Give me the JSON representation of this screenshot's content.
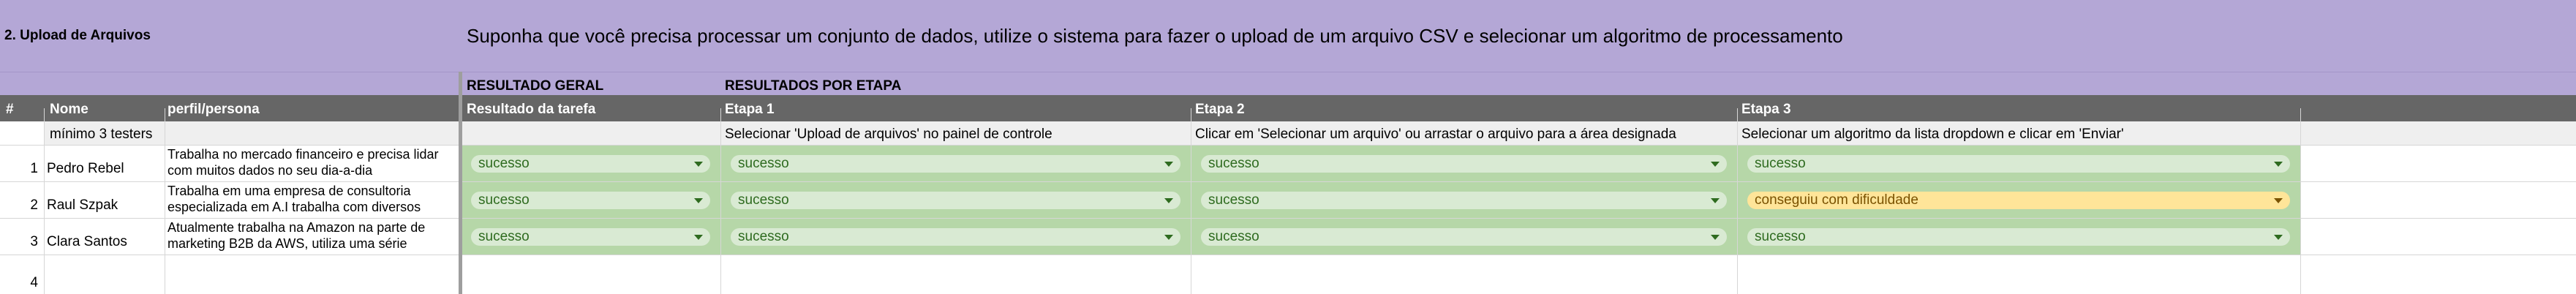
{
  "section_title": "2. Upload de Arquivos",
  "task_prompt": "Suponha que você precisa processar um conjunto de dados, utilize o sistema para fazer o upload de um arquivo CSV e selecionar um algoritmo de processamento",
  "group_headers": {
    "overall": "RESULTADO GERAL",
    "by_stage": "RESULTADOS POR ETAPA"
  },
  "columns": {
    "num": "#",
    "name": "Nome",
    "persona": "perfil/persona",
    "task_result": "Resultado da tarefa",
    "stage1": "Etapa 1",
    "stage2": "Etapa 2",
    "stage3": "Etapa 3"
  },
  "instructions": {
    "testers": "mínimo 3 testers",
    "stage1": "Selecionar 'Upload de arquivos' no painel de controle",
    "stage2": "Clicar em 'Selecionar um arquivo' ou arrastar o arquivo para a área designada",
    "stage3": "Selecionar um algoritmo da lista dropdown e clicar em 'Enviar'"
  },
  "rows": [
    {
      "num": "1",
      "name": "Pedro Rebel",
      "persona": "Trabalha no mercado financeiro e precisa lidar com muitos dados no seu dia-a-dia",
      "task_result": "sucesso",
      "stage1": "sucesso",
      "stage2": "sucesso",
      "stage3": "sucesso"
    },
    {
      "num": "2",
      "name": "Raul Szpak",
      "persona": "Trabalha em uma empresa de consultoria especializada em A.I trabalha com diversos",
      "task_result": "sucesso",
      "stage1": "sucesso",
      "stage2": "sucesso",
      "stage3": "conseguiu com dificuldade"
    },
    {
      "num": "3",
      "name": "Clara Santos",
      "persona": "Atualmente trabalha na Amazon na parte de marketing B2B da AWS, utiliza uma série",
      "task_result": "sucesso",
      "stage1": "sucesso",
      "stage2": "sucesso",
      "stage3": "sucesso"
    },
    {
      "num": "4"
    }
  ],
  "colors": {
    "header_purple": "#b4a7d6",
    "header_dark": "#666666",
    "result_green": "#b6d7a8",
    "chip_green": "#d9ead3",
    "chip_yellow": "#ffe599"
  }
}
